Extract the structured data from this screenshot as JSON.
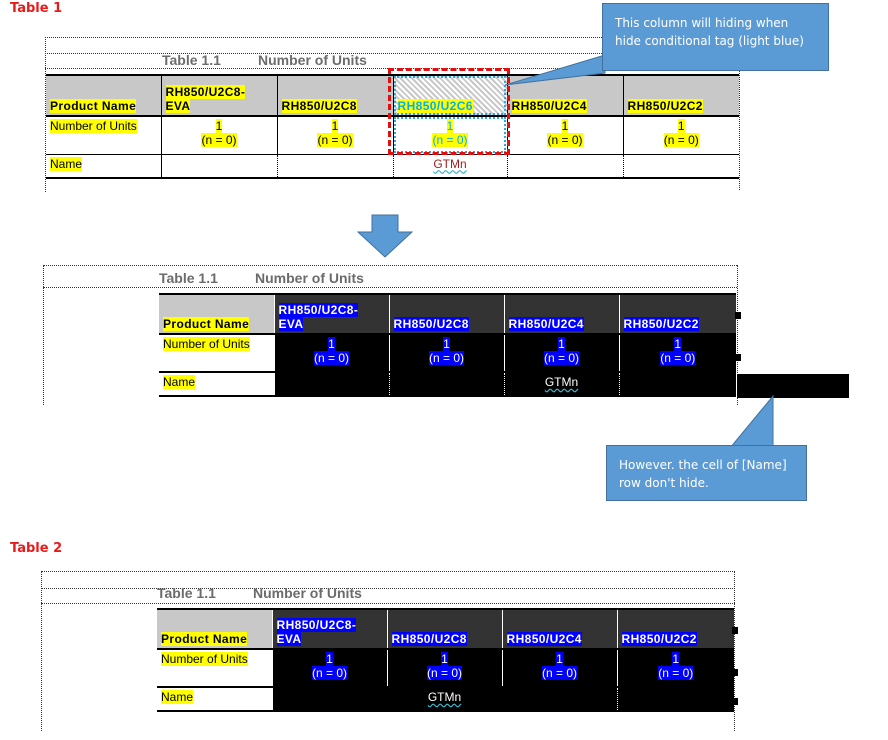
{
  "table1": {
    "section_label": "Table 1",
    "caption_number": "Table 1.1",
    "caption_title": "Number of Units",
    "row_headers": [
      "Product Name",
      "Number of Units",
      "Name"
    ],
    "columns": [
      "RH850/U2C8-EVA",
      "RH850/U2C8",
      "RH850/U2C6",
      "RH850/U2C4",
      "RH850/U2C2"
    ],
    "column_head_lines": [
      [
        "RH850/U2C8-",
        "EVA"
      ],
      [
        "",
        "RH850/U2C8"
      ],
      [
        "",
        "RH850/U2C6"
      ],
      [
        "",
        "RH850/U2C4"
      ],
      [
        "",
        "RH850/U2C2"
      ]
    ],
    "units_value": "1",
    "units_n": "(n = 0)",
    "name_row_value": "GTMn",
    "conditional_column": "RH850/U2C6",
    "conditional_tag_color": "#00b0f0"
  },
  "callout_top": {
    "text": "This column will hiding when hide conditional tag (light blue)"
  },
  "table1_result": {
    "caption_number": "Table 1.1",
    "caption_title": "Number of Units",
    "row_headers": [
      "Product Name",
      "Number of Units",
      "Name"
    ],
    "column_head_lines": [
      [
        "RH850/U2C8-",
        "EVA"
      ],
      [
        "",
        "RH850/U2C8"
      ],
      [
        "",
        "RH850/U2C4"
      ],
      [
        "",
        "RH850/U2C2"
      ]
    ],
    "units_value": "1",
    "units_n": "(n = 0)",
    "name_row_value": "GTMn"
  },
  "callout_bottom": {
    "text": "However. the cell of [Name] row don't hide."
  },
  "table2": {
    "section_label": "Table 2",
    "caption_number": "Table 1.1",
    "caption_title": "Number of Units",
    "row_headers": [
      "Product Name",
      "Number of Units",
      "Name"
    ],
    "column_head_lines": [
      [
        "RH850/U2C8-",
        "EVA"
      ],
      [
        "",
        "RH850/U2C8"
      ],
      [
        "",
        "RH850/U2C4"
      ],
      [
        "",
        "RH850/U2C2"
      ]
    ],
    "units_value": "1",
    "units_n": "(n = 0)",
    "name_row_value": "GTMn"
  },
  "colors": {
    "label_red": "#e81b1b",
    "callout_blue": "#5b9bd5",
    "highlight_yellow": "#ffff00",
    "highlight_blue": "#0000ff",
    "header_gray": "#c8c8c8",
    "dark_header": "#333333",
    "selection_dashed_red": "#e01010"
  }
}
